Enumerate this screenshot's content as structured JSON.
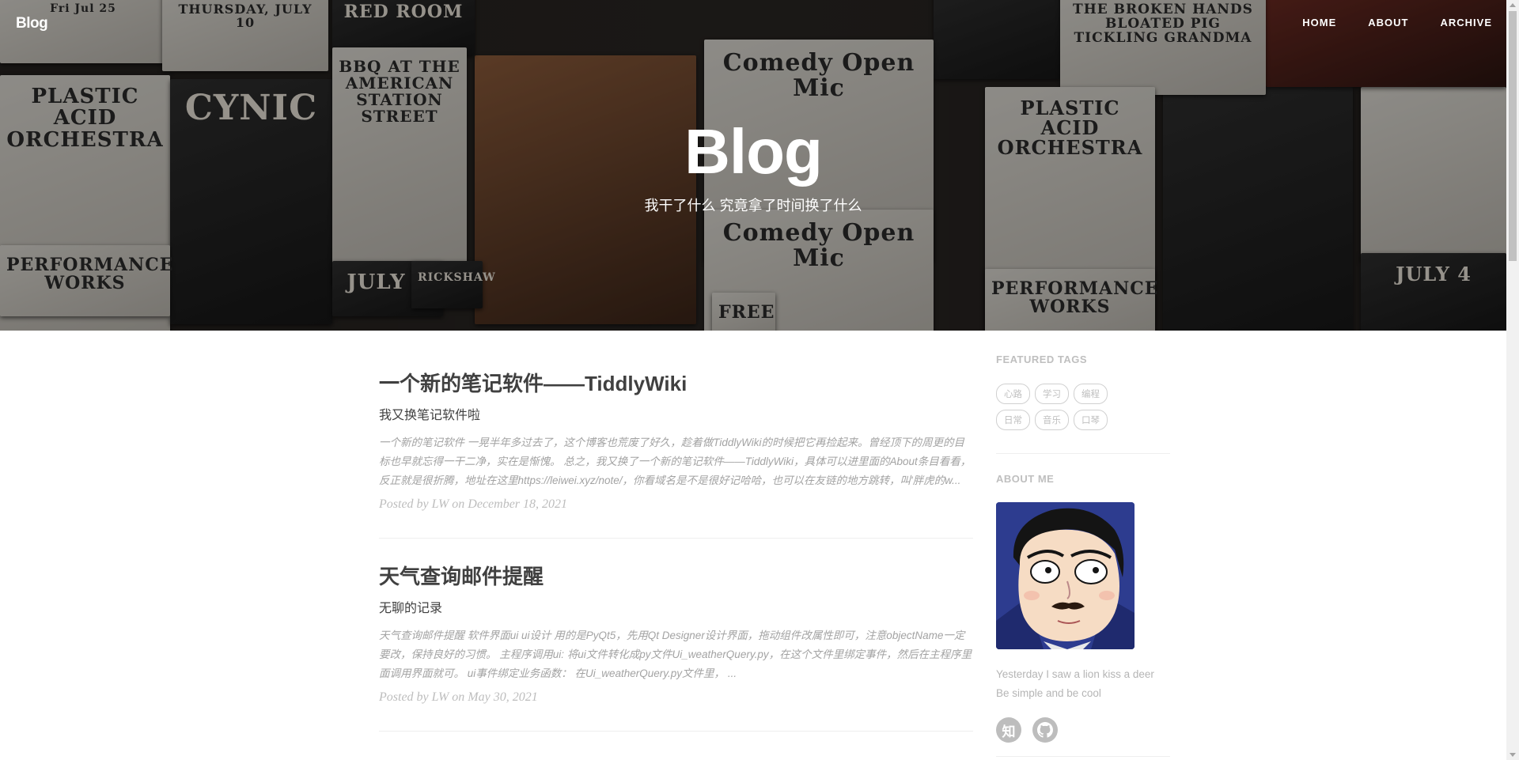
{
  "nav": {
    "brand": "Blog",
    "links": [
      "HOME",
      "ABOUT",
      "ARCHIVE"
    ]
  },
  "hero": {
    "title": "Blog",
    "subtitle": "我干了什么 究竟拿了时间换了什么",
    "posters": [
      "Fri Jul 25",
      "THURSDAY, JULY 10",
      "RED ROOM",
      "THE BROKEN HANDS BLOATED PIG TICKLING GRANDMA",
      "PLASTIC ACID ORCHESTRA",
      "CYNIC",
      "BBQ AT THE AMERICAN STATION STREET",
      "Comedy Open Mic",
      "Comedy Open Mic",
      "PERFORMANCE WORKS",
      "JULY 4",
      "RICKSHAW",
      "FREE",
      "PLASTIC ACID ORCHESTRA",
      "PERFORMANCE WORKS",
      "JULY 4"
    ]
  },
  "posts": [
    {
      "title": "一个新的笔记软件——TiddlyWiki",
      "subtitle": "我又换笔记软件啦",
      "excerpt": "一个新的笔记软件 一晃半年多过去了，这个博客也荒废了好久，趁着做TiddlyWiki的时候把它再捡起来。曾经顶下的周更的目标也早就忘得一干二净，实在是惭愧。 总之，我又换了一个新的笔记软件——TiddlyWiki，具体可以进里面的About条目看看，反正就是很折腾，地址在这里https://leiwei.xyz/note/，你看域名是不是很好记哈哈，也可以在友链的地方跳转，叫'胖虎的w...",
      "meta": "Posted by LW on December 18, 2021"
    },
    {
      "title": "天气查询邮件提醒",
      "subtitle": "无聊的记录",
      "excerpt": "天气查询邮件提醒 软件界面ui ui设计 用的是PyQt5，先用Qt Designer设计界面，拖动组件改属性即可，注意objectName一定要改，保持良好的习惯。 主程序调用ui: 将ui文件转化成py文件Ui_weatherQuery.py，在这个文件里绑定事件，然后在主程序里面调用界面就可。 ui事件绑定业务函数： 在Ui_weatherQuery.py文件里， ...",
      "meta": "Posted by LW on May 30, 2021"
    }
  ],
  "sidebar": {
    "featured_tags_heading": "FEATURED TAGS",
    "tags": [
      "心路",
      "学习",
      "编程",
      "日常",
      "音乐",
      "口琴"
    ],
    "about_heading": "ABOUT ME",
    "bio_lines": [
      "Yesterday I saw a lion kiss a deer",
      "Be simple and be cool"
    ],
    "social": [
      {
        "icon": "zhihu-icon",
        "glyph": "知"
      },
      {
        "icon": "github-icon",
        "glyph": ""
      }
    ]
  }
}
